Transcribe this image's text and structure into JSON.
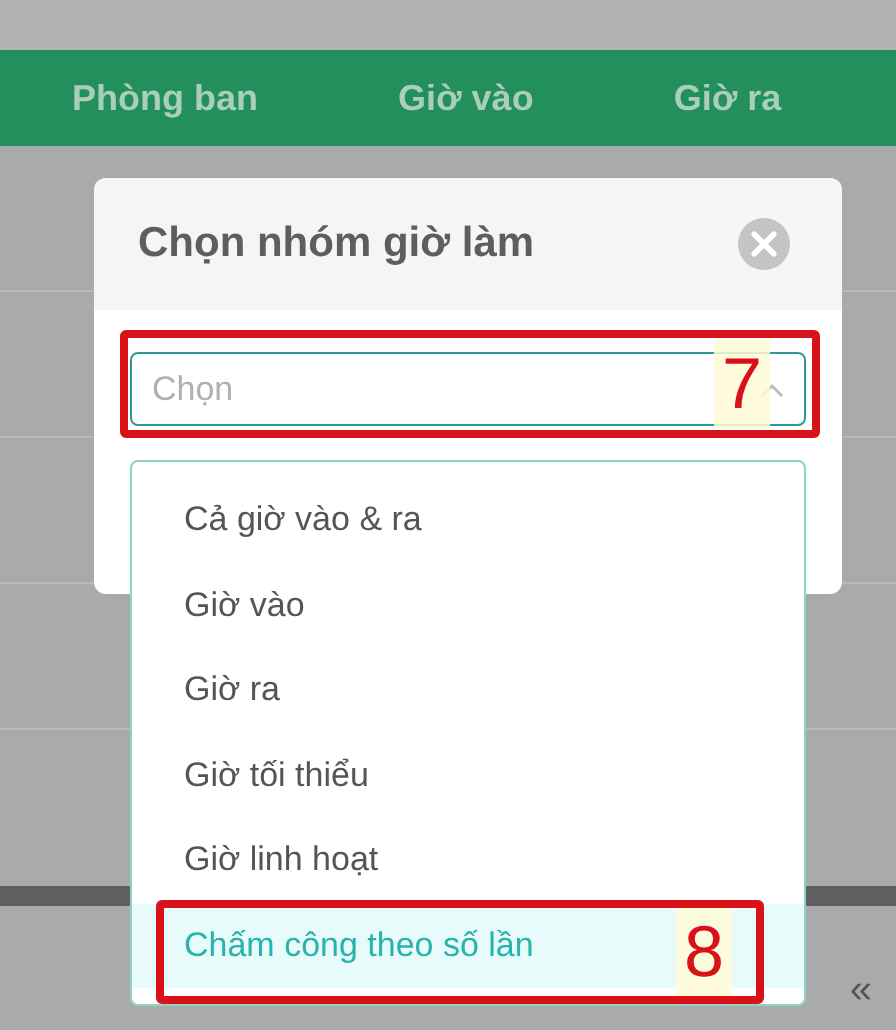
{
  "table": {
    "columns": [
      "Phòng ban",
      "Giờ vào",
      "Giờ ra"
    ]
  },
  "dialog": {
    "title": "Chọn nhóm giờ làm",
    "select": {
      "placeholder": "Chọn",
      "expanded": true
    },
    "options": [
      {
        "label": "Cả giờ vào & ra",
        "selected": false
      },
      {
        "label": "Giờ vào",
        "selected": false
      },
      {
        "label": "Giờ ra",
        "selected": false
      },
      {
        "label": "Giờ tối thiểu",
        "selected": false
      },
      {
        "label": "Giờ linh hoạt",
        "selected": false
      },
      {
        "label": "Chấm công theo số lần",
        "selected": true
      }
    ]
  },
  "annotations": [
    "7",
    "8"
  ],
  "pager": {
    "collapse": "«"
  }
}
